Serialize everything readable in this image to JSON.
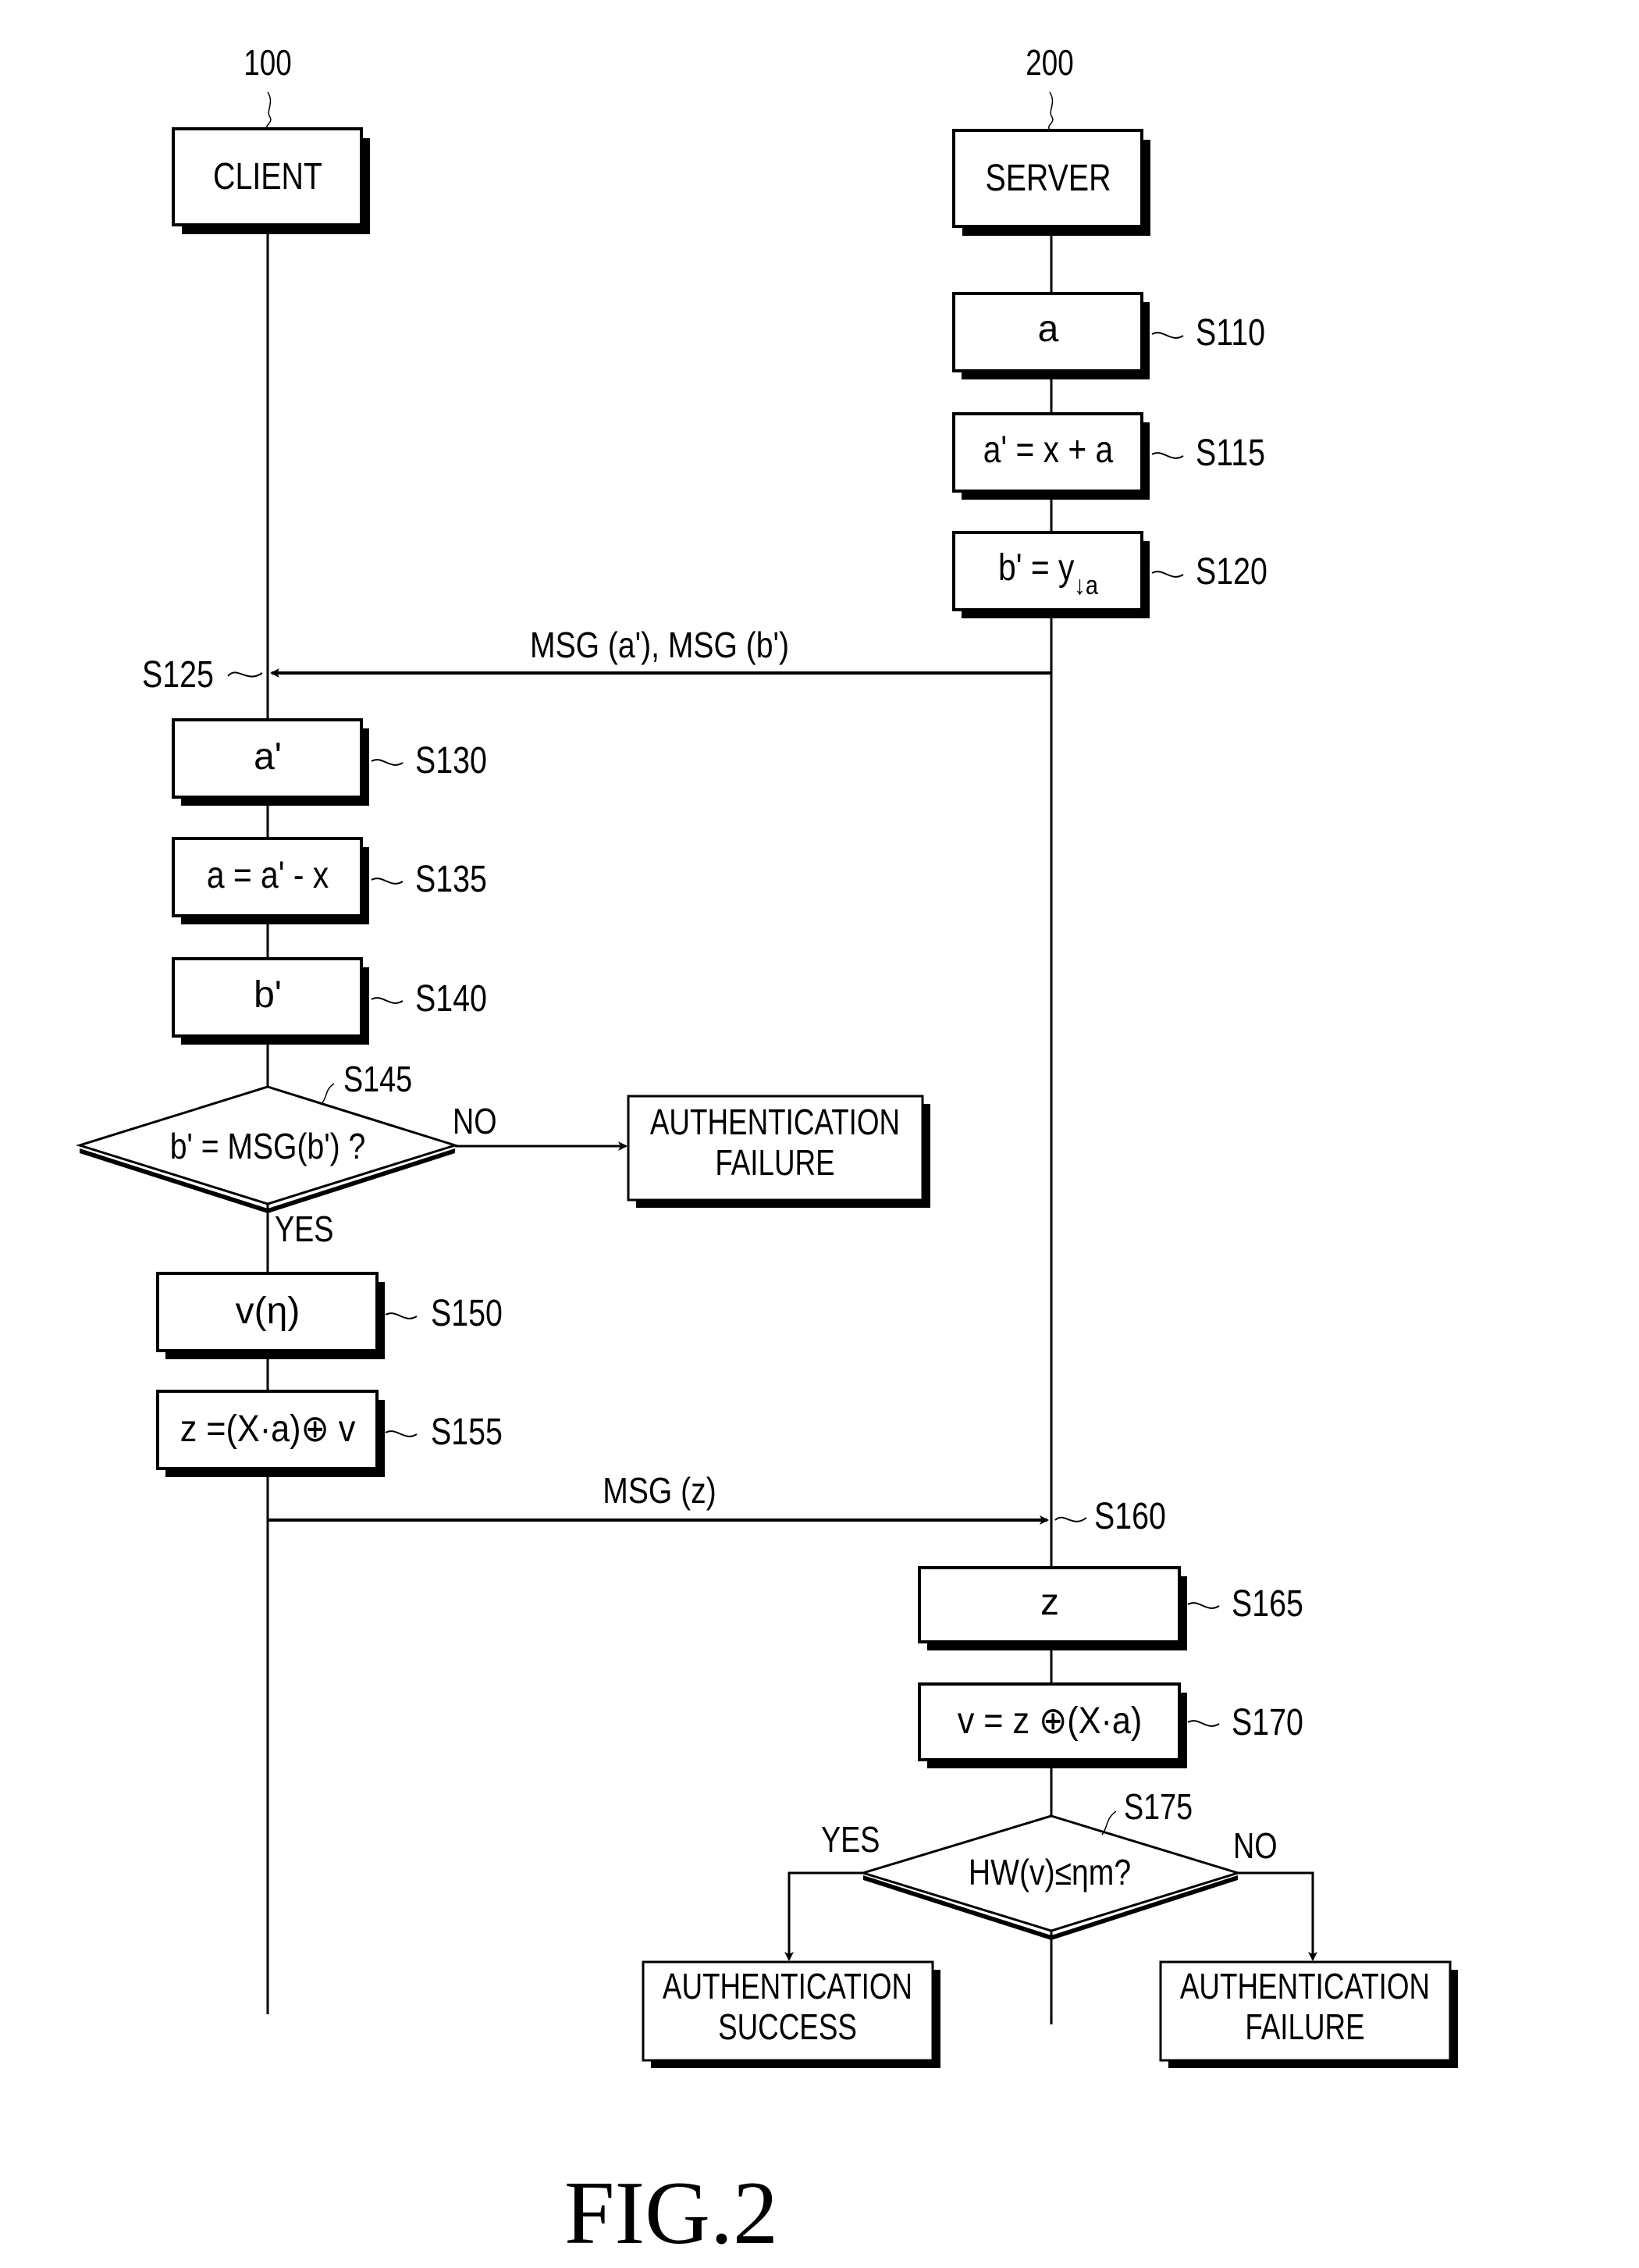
{
  "figure": {
    "caption": "FIG.2",
    "colors": {
      "ink": "#000000",
      "paper": "#ffffff"
    }
  },
  "lanes": {
    "client": {
      "ref": "100",
      "label": "CLIENT"
    },
    "server": {
      "ref": "200",
      "label": "SERVER"
    }
  },
  "server_steps": [
    {
      "id": "S110",
      "text": "a"
    },
    {
      "id": "S115",
      "text": "a' = x + a"
    },
    {
      "id": "S120",
      "text_main": "b' = y",
      "text_sub": "↓a"
    }
  ],
  "messages": [
    {
      "id": "S125",
      "label": "MSG (a'), MSG (b')",
      "direction": "server-to-client"
    },
    {
      "id": "S160",
      "label": "MSG (z)",
      "direction": "client-to-server"
    }
  ],
  "client_steps": [
    {
      "id": "S130",
      "text": "a'"
    },
    {
      "id": "S135",
      "text": "a = a' - x"
    },
    {
      "id": "S140",
      "text": "b'"
    },
    {
      "id": "S150",
      "text": "v(η)"
    },
    {
      "id": "S155",
      "text": "z =(X·a)⊕ v"
    }
  ],
  "client_decision": {
    "id": "S145",
    "text": "b' = MSG(b') ?",
    "no_label": "NO",
    "yes_label": "YES",
    "no_result": [
      "AUTHENTICATION",
      "FAILURE"
    ]
  },
  "server_steps_2": [
    {
      "id": "S165",
      "text": "z"
    },
    {
      "id": "S170",
      "text": "v = z ⊕(X·a)"
    }
  ],
  "server_decision": {
    "id": "S175",
    "text": "HW(v)≤ηm?",
    "yes_label": "YES",
    "no_label": "NO",
    "yes_result": [
      "AUTHENTICATION",
      "SUCCESS"
    ],
    "no_result": [
      "AUTHENTICATION",
      "FAILURE"
    ]
  }
}
